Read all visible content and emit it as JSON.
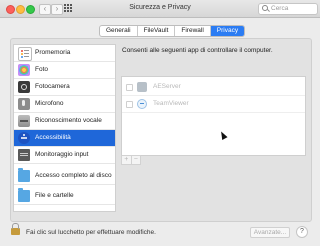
{
  "window": {
    "title": "Sicurezza e Privacy",
    "search_placeholder": "Cerca"
  },
  "nav": {
    "back_glyph": "‹",
    "forward_glyph": "›"
  },
  "tabs": [
    {
      "label": "Generali",
      "selected": false
    },
    {
      "label": "FileVault",
      "selected": false
    },
    {
      "label": "Firewall",
      "selected": false
    },
    {
      "label": "Privacy",
      "selected": true
    }
  ],
  "sidebar": {
    "items": [
      {
        "label": "Promemoria",
        "icon": "reminders-icon",
        "selected": false
      },
      {
        "label": "Foto",
        "icon": "photos-icon",
        "selected": false
      },
      {
        "label": "Fotocamera",
        "icon": "camera-icon",
        "selected": false
      },
      {
        "label": "Microfono",
        "icon": "microphone-icon",
        "selected": false
      },
      {
        "label": "Riconoscimento vocale",
        "icon": "speech-recognition-icon",
        "selected": false
      },
      {
        "label": "Accessibilità",
        "icon": "accessibility-icon",
        "selected": true
      },
      {
        "label": "Monitoraggio input",
        "icon": "input-monitoring-icon",
        "selected": false
      },
      {
        "label": "Accesso completo al disco",
        "icon": "folder-icon",
        "selected": false
      },
      {
        "label": "File e cartelle",
        "icon": "folder-icon",
        "selected": false
      }
    ]
  },
  "main": {
    "caption": "Consenti alle seguenti app di controllare il computer.",
    "apps": [
      {
        "name": "AEServer",
        "icon": "aeserver-icon",
        "checked": false
      },
      {
        "name": "TeamViewer",
        "icon": "teamviewer-icon",
        "checked": false
      }
    ],
    "add_label": "+",
    "remove_label": "−"
  },
  "footer": {
    "lock_text": "Fai clic sul lucchetto per effettuare modifiche.",
    "advanced_label": "Avanzate...",
    "help_label": "?"
  },
  "colors": {
    "accent": "#1f67d9",
    "tab_selected": "#2b7cf3"
  }
}
